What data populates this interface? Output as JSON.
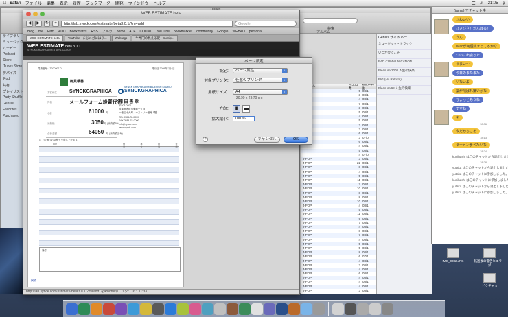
{
  "menubar": {
    "app": "Safari",
    "items": [
      "ファイル",
      "編集",
      "表示",
      "履歴",
      "ブックマーク",
      "開発",
      "ウインドウ",
      "ヘルプ"
    ],
    "clock": "21:05"
  },
  "itunes": {
    "title": "iTunes",
    "album_header": "アルバム",
    "view_label": "表示",
    "search_label": "検索",
    "sidebar": [
      "ライブラリ",
      "ミュージック",
      "ムービー",
      "Podcast",
      "Store",
      "iTunes Store",
      "デバイス",
      "iPod",
      "共有",
      "プレイリスト",
      "Party Shuffle",
      "Genius",
      "Favorites",
      "Purchased"
    ],
    "list_header": [
      "ジャンル",
      "再生回数",
      "最後に再生"
    ],
    "rows": [
      [
        "",
        "5",
        "08/1"
      ],
      [
        "",
        "3",
        "08/1"
      ],
      [
        "",
        "4",
        "08/1"
      ],
      [
        "",
        "7",
        "08/1"
      ],
      [
        "",
        "3",
        "08/1"
      ],
      [
        "",
        "5",
        "08/1"
      ],
      [
        "",
        "4",
        "08/1"
      ],
      [
        "",
        "5",
        "08/1"
      ],
      [
        "",
        "3",
        "08/1"
      ],
      [
        "",
        "3",
        "08/1"
      ],
      [
        "",
        "6",
        "08/1"
      ],
      [
        "",
        "3",
        "07/0"
      ],
      [
        "",
        "6",
        "08/1"
      ],
      [
        "",
        "4",
        "08/1"
      ],
      [
        "",
        "5",
        "08/1"
      ],
      [
        "",
        "4",
        "07/0"
      ],
      [
        "J-POP",
        "3",
        "08/1"
      ],
      [
        "J-POP",
        "22",
        "08/1"
      ],
      [
        "J-POP",
        "8",
        "08/1"
      ],
      [
        "J-POP",
        "4",
        "08/1"
      ],
      [
        "J-POP",
        "5",
        "08/1"
      ],
      [
        "J-POP",
        "11",
        "08/1"
      ],
      [
        "J-POP",
        "7",
        "08/1"
      ],
      [
        "J-POP",
        "10",
        "08/1"
      ],
      [
        "J-POP",
        "8",
        "08/1"
      ],
      [
        "J-POP",
        "8",
        "08/1"
      ],
      [
        "J-POP",
        "10",
        "08/1"
      ],
      [
        "J-POP",
        "4",
        "08/1"
      ],
      [
        "J-POP",
        "5",
        "08/1"
      ],
      [
        "J-POP",
        "11",
        "08/1"
      ],
      [
        "J-POP",
        "9",
        "08/1"
      ],
      [
        "J-POP",
        "7",
        "08/1"
      ],
      [
        "J-POP",
        "4",
        "08/1"
      ],
      [
        "J-POP",
        "8",
        "08/1"
      ],
      [
        "J-POP",
        "7",
        "08/1"
      ],
      [
        "J-POP",
        "4",
        "08/1"
      ],
      [
        "J-POP",
        "5",
        "08/1"
      ],
      [
        "J-POP",
        "5",
        "08/1"
      ],
      [
        "J-POP",
        "8",
        "08/1"
      ],
      [
        "J-POP",
        "6",
        "07/1"
      ],
      [
        "J-POP",
        "4",
        "08/1"
      ],
      [
        "J-POP",
        "3",
        "08/1"
      ],
      [
        "J-POP",
        "4",
        "08/1"
      ],
      [
        "J-POP",
        "6",
        "08/1"
      ],
      [
        "J-POP",
        "4",
        "08/1"
      ],
      [
        "J-POP",
        "4",
        "08/1"
      ],
      [
        "J-POP",
        "4",
        "08/1"
      ],
      [
        "J-POP",
        "3",
        "08/1"
      ]
    ],
    "rpanel_title": "Genius サイドバー",
    "rpanel_items": [
      "ミュージック・トラック",
      "いつか愛でこそ",
      "BAD COMMUNICATION",
      "Pleasure 2008 人生の快楽",
      "BIG (No Reform)",
      "Pleasure'98 人生の快楽"
    ]
  },
  "chat": {
    "title": "(iamaj) でチャット中",
    "bubbles": [
      {
        "text": "かわいい",
        "style": "y"
      },
      {
        "text": "ひさびさ！がんばる！",
        "style": "b"
      },
      {
        "text": "うん",
        "style": "y"
      },
      {
        "text": "iMacが何個集まってるかな",
        "style": "y"
      },
      {
        "text": "ついに出会った",
        "style": "b"
      },
      {
        "text": "うまい～",
        "style": "y"
      },
      {
        "text": "今日のまたまた",
        "style": "b"
      },
      {
        "text": "いないよ",
        "style": "y"
      },
      {
        "text": "論が飛ばれ嫌いかな",
        "style": "y"
      },
      {
        "text": "ちょっともうね",
        "style": "b"
      },
      {
        "text": "ですね",
        "style": "b"
      },
      {
        "text": "を",
        "style": "y"
      },
      {
        "text": "今だからこそ",
        "style": "y"
      },
      {
        "text": "ラーメン食べたいな",
        "style": "y"
      }
    ],
    "timestamps": [
      "18:06",
      "18:13",
      "18:24",
      "18:28"
    ],
    "system_msgs": [
      "kunihashi はこのチャットから退出しました。",
      "yutaka はこのチャットから退出しました。",
      "yutaka はこのチャットに参加しました。",
      "kunihashi はこのチャットに参加しました。",
      "yutaka はこのチャットから退出しました。",
      "yutaka はこのチャットに参加しました。"
    ]
  },
  "safari": {
    "title": "WEB ESTIMATE beta",
    "url": "http://lab.synck.com/estimate/beta3.0.1/?m=add",
    "search_placeholder": "Google",
    "bookmarks": [
      "Blog",
      "me",
      "Fam",
      "ADD",
      "Bookmarks",
      "RSS",
      "アルク",
      "home",
      "ALF",
      "COUNT",
      "YouTube",
      "bookmarklet",
      "community",
      "Google",
      "WEBAD",
      "personal"
    ],
    "tabs": [
      "WEB ESTIMATE beta",
      "YouTube - まじメガにはり...",
      "Webfags",
      "牛丼円の見える足 - Sumip..."
    ],
    "status": "http://lab.synck.com/estimate/beta3.0.1/?m=add' をiPhoneの...ルク：16：11:33"
  },
  "webestimate": {
    "brand": "WEB ESTIMATE",
    "brand_version": "beta 3.0.1",
    "brand_sub": "SYNCK GRAPHICA WEB APPLICATION",
    "doc_no": "見積番号：T200907-01",
    "doc_date": "発行日 2009年7月4日",
    "company_logo_text": "御見積書",
    "client_label": "お客様名",
    "client": "SYNCKGRAPHICA",
    "subject_label": "件名",
    "subject": "メールフォーム設置代行",
    "amount_label": "小計",
    "amount": "61000",
    "tax_label": "消費税",
    "tax": "3050",
    "total_label": "合計金額",
    "total": "64050",
    "currency": "円",
    "tax_note": "(消費税5%)",
    "total_note": "(消費税込み)",
    "issuer_logo": "SYNCKGRAPHICA",
    "issuer_tagline": "SYNCK GRAPHICA WEB DESIGN STUDIO",
    "issuer_person": "和 田 善 幸",
    "issuer_addr": [
      "〒503-0801",
      "岐阜県大垣市東町一丁目",
      "一番三十九号ノーストリー番地 1階",
      "TEL 0584-78-0000",
      "FAX 0584-78-0000",
      "info@synck.com",
      "www.synck.com"
    ],
    "intro": "以下の通りお見積もり申し上げます。",
    "table_headers": [
      "摘要",
      "数量",
      "単位",
      "単価",
      "金額"
    ],
    "notes_label": "備考",
    "footer_link": "戻る"
  },
  "page_setup": {
    "title": "ページ設定",
    "settings_label": "設定：",
    "settings_value": "ページ属性",
    "printer_label": "対象プリンタ：",
    "printer_value": "任意のプリンタ",
    "paper_label": "用紙サイズ：",
    "paper_value": "A4",
    "paper_dims": "20.99 x 29.70 cm",
    "orientation_label": "方向：",
    "scale_label": "拡大縮小：",
    "scale_value": "100 %",
    "cancel": "キャンセル",
    "ok": "OK",
    "help": "?"
  },
  "desktop": {
    "icons": [
      "IMG_0082.JPG",
      "転送後の警告ヒエラーが",
      "ピクチャ 4"
    ]
  },
  "dock": {
    "colors": [
      "#3b6fd1",
      "#2e8b57",
      "#e08a2a",
      "#c94a3a",
      "#7a4fb5",
      "#3d9ad8",
      "#d4b83a",
      "#5a5a5a",
      "#2c7bd8",
      "#a8c23c",
      "#d85b8f",
      "#4fa0c0",
      "#c0c0c0",
      "#8c5a3c",
      "#3c8c5a",
      "#e0e0e0",
      "#6a6aba",
      "#2a4f8a",
      "#ba6a2a",
      "#7ab4e8",
      "#9a9a9a",
      "#d2d2d2",
      "#555",
      "#aaa",
      "#ccc",
      "#888"
    ]
  }
}
